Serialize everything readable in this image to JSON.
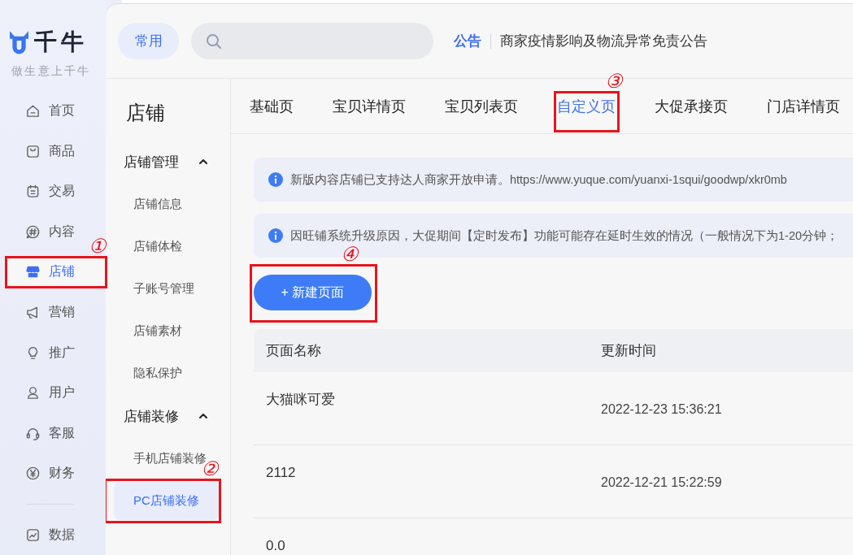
{
  "brand": {
    "name": "千牛",
    "slogan": "做生意上千牛"
  },
  "nav_sections": [
    {
      "items": [
        {
          "label": "首页",
          "selected": false
        },
        {
          "label": "商品",
          "selected": false
        },
        {
          "label": "交易",
          "selected": false
        },
        {
          "label": "内容",
          "selected": false
        },
        {
          "label": "店铺",
          "selected": true,
          "callout": "①"
        },
        {
          "label": "营销",
          "selected": false
        },
        {
          "label": "推广",
          "selected": false
        },
        {
          "label": "用户",
          "selected": false
        },
        {
          "label": "客服",
          "selected": false
        },
        {
          "label": "财务",
          "selected": false
        }
      ]
    },
    {
      "items": [
        {
          "label": "数据",
          "selected": false
        }
      ]
    }
  ],
  "header": {
    "shortcut_button": "常用",
    "announcement": {
      "tag": "公告",
      "text": "商家疫情影响及物流异常免责公告"
    }
  },
  "section_title": "店铺",
  "submenu": [
    {
      "label": "店铺管理",
      "expanded": true,
      "children": [
        {
          "label": "店铺信息",
          "selected": false
        },
        {
          "label": "店铺体检",
          "selected": false
        },
        {
          "label": "子账号管理",
          "selected": false
        },
        {
          "label": "店铺素材",
          "selected": false
        },
        {
          "label": "隐私保护",
          "selected": false
        }
      ]
    },
    {
      "label": "店铺装修",
      "expanded": true,
      "children": [
        {
          "label": "手机店铺装修",
          "selected": false
        },
        {
          "label": "PC店铺装修",
          "selected": true,
          "callout": "②"
        }
      ]
    }
  ],
  "tabs": [
    {
      "label": "基础页",
      "selected": false
    },
    {
      "label": "宝贝详情页",
      "selected": false
    },
    {
      "label": "宝贝列表页",
      "selected": false
    },
    {
      "label": "自定义页",
      "selected": true,
      "callout": "③"
    },
    {
      "label": "大促承接页",
      "selected": false
    },
    {
      "label": "门店详情页",
      "selected": false
    }
  ],
  "alerts": [
    {
      "text": "新版内容店铺已支持达人商家开放申请。https://www.yuque.com/yuanxi-1squi/goodwp/xkr0mb"
    },
    {
      "text": "因旺铺系统升级原因，大促期间【定时发布】功能可能存在延时生效的情况（一般情况下为1-20分钟；"
    }
  ],
  "create_button": {
    "label": "+ 新建页面",
    "callout": "④"
  },
  "table": {
    "columns": [
      "页面名称",
      "更新时间"
    ],
    "rows": [
      [
        "大猫咪可爱",
        "2022-12-23 15:36:21"
      ],
      [
        "2112",
        "2022-12-21 15:22:59"
      ],
      [
        "0.0"
      ]
    ]
  }
}
